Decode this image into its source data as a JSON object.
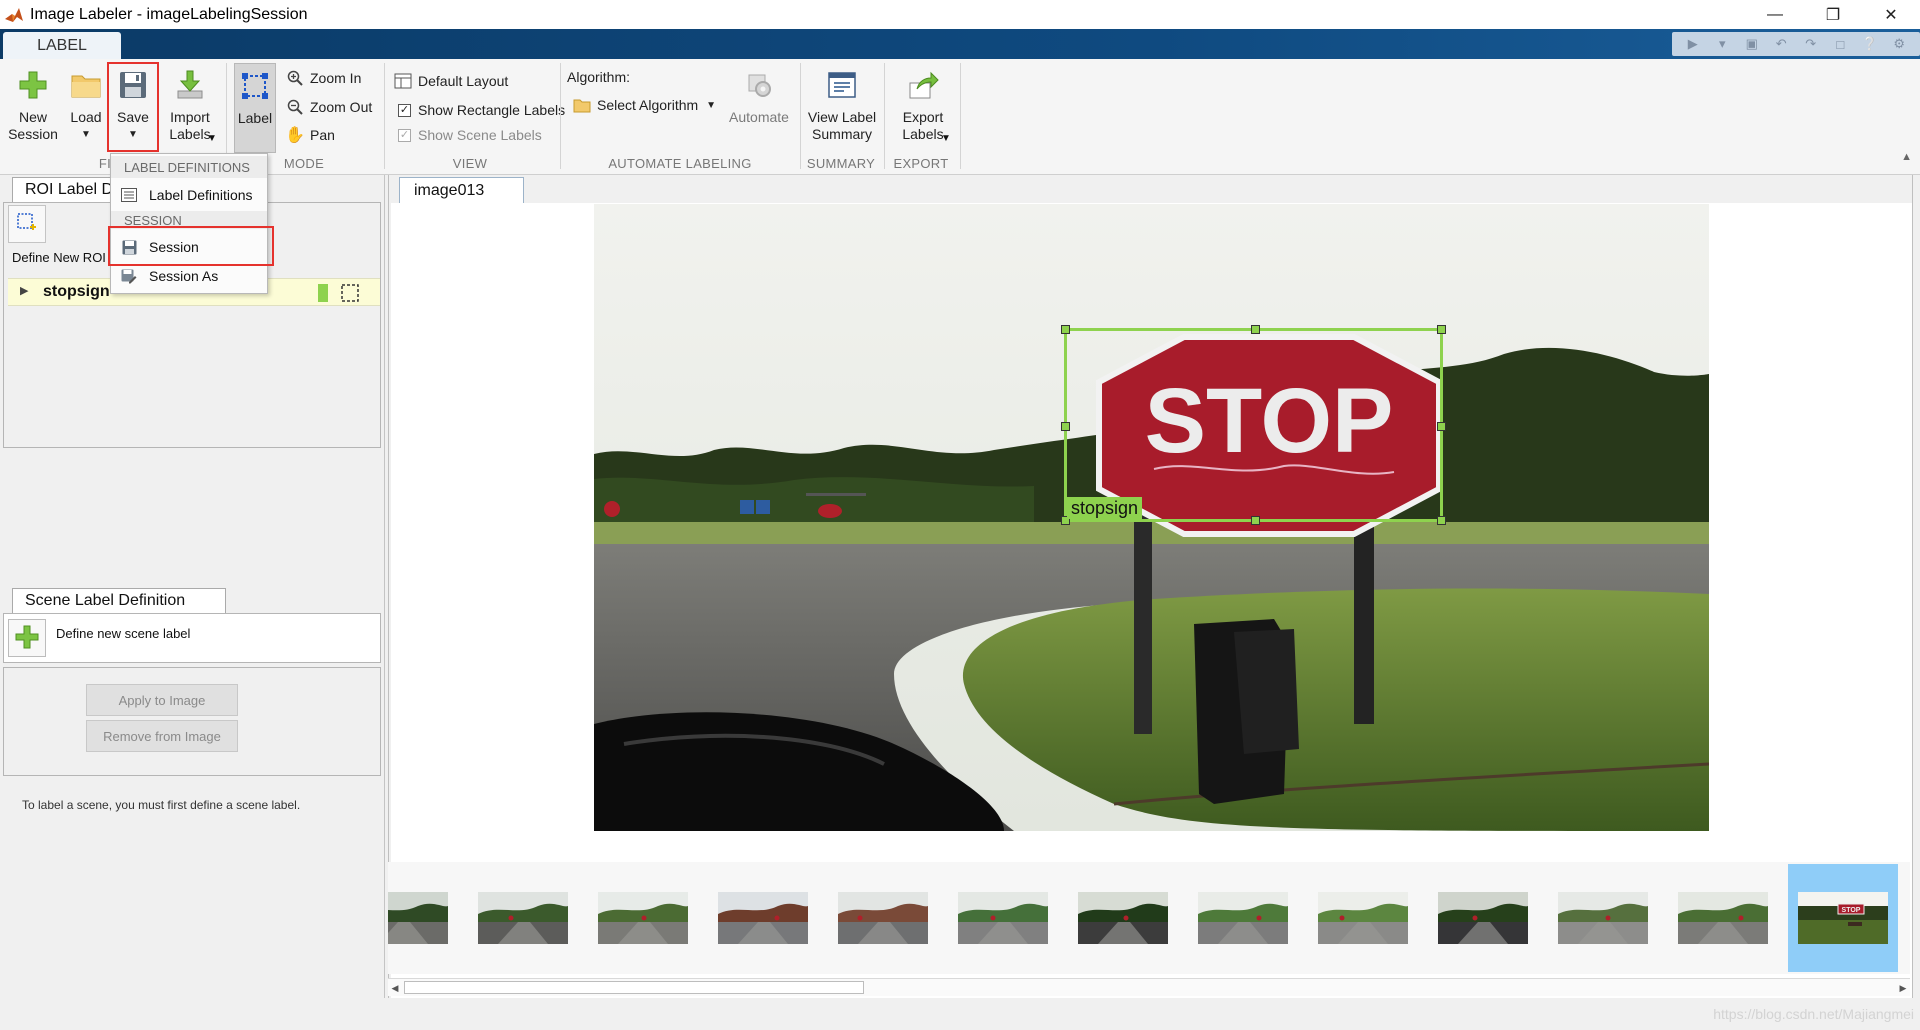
{
  "window": {
    "title": "Image Labeler - imageLabelingSession",
    "controls": [
      "minimize",
      "restore",
      "close"
    ]
  },
  "tabs": {
    "label": "LABEL"
  },
  "ribbon": {
    "file": {
      "new_session": "New\nSession",
      "load": "Load",
      "save": "Save",
      "import_labels": "Import\nLabels",
      "group_label": "FILE"
    },
    "mode": {
      "label": "Label",
      "zoom_in": "Zoom In",
      "zoom_out": "Zoom Out",
      "pan": "Pan",
      "group_label": "MODE"
    },
    "view": {
      "default_layout": "Default Layout",
      "show_rectangle_labels": "Show Rectangle Labels",
      "show_rectangle_labels_checked": true,
      "show_scene_labels": "Show Scene Labels",
      "show_scene_labels_checked": true,
      "group_label": "VIEW"
    },
    "automate": {
      "algorithm_label": "Algorithm:",
      "select_algorithm": "Select Algorithm",
      "automate": "Automate",
      "group_label": "AUTOMATE LABELING"
    },
    "summary": {
      "view_label_summary": "View Label\nSummary",
      "group_label": "SUMMARY"
    },
    "export": {
      "export_labels": "Export\nLabels",
      "group_label": "EXPORT"
    }
  },
  "save_menu": {
    "header_label_definitions": "LABEL DEFINITIONS",
    "item_label_definitions": "Label Definitions",
    "header_session": "SESSION",
    "item_session": "Session",
    "item_session_as": "Session As"
  },
  "roi_panel": {
    "tab_title": "ROI Label Definition",
    "define_new_roi": "Define New ROI",
    "labels": [
      {
        "name": "stopsign",
        "color": "#8ed24e"
      }
    ]
  },
  "scene_panel": {
    "tab_title": "Scene Label Definition",
    "define_new": "Define new scene label",
    "apply_button": "Apply to Image",
    "remove_button": "Remove from Image",
    "hint": "To label a scene, you must first define a scene label."
  },
  "image_view": {
    "tab_name": "image013",
    "roi_label": "stopsign",
    "sign_text": "STOP",
    "accent_color": "#8ed24e"
  },
  "filmstrip": {
    "count": 13,
    "selected_index": 12,
    "thumb_sign_text": "STOP"
  },
  "statusbar": {
    "watermark": "https://blog.csdn.net/Majiangmei"
  }
}
